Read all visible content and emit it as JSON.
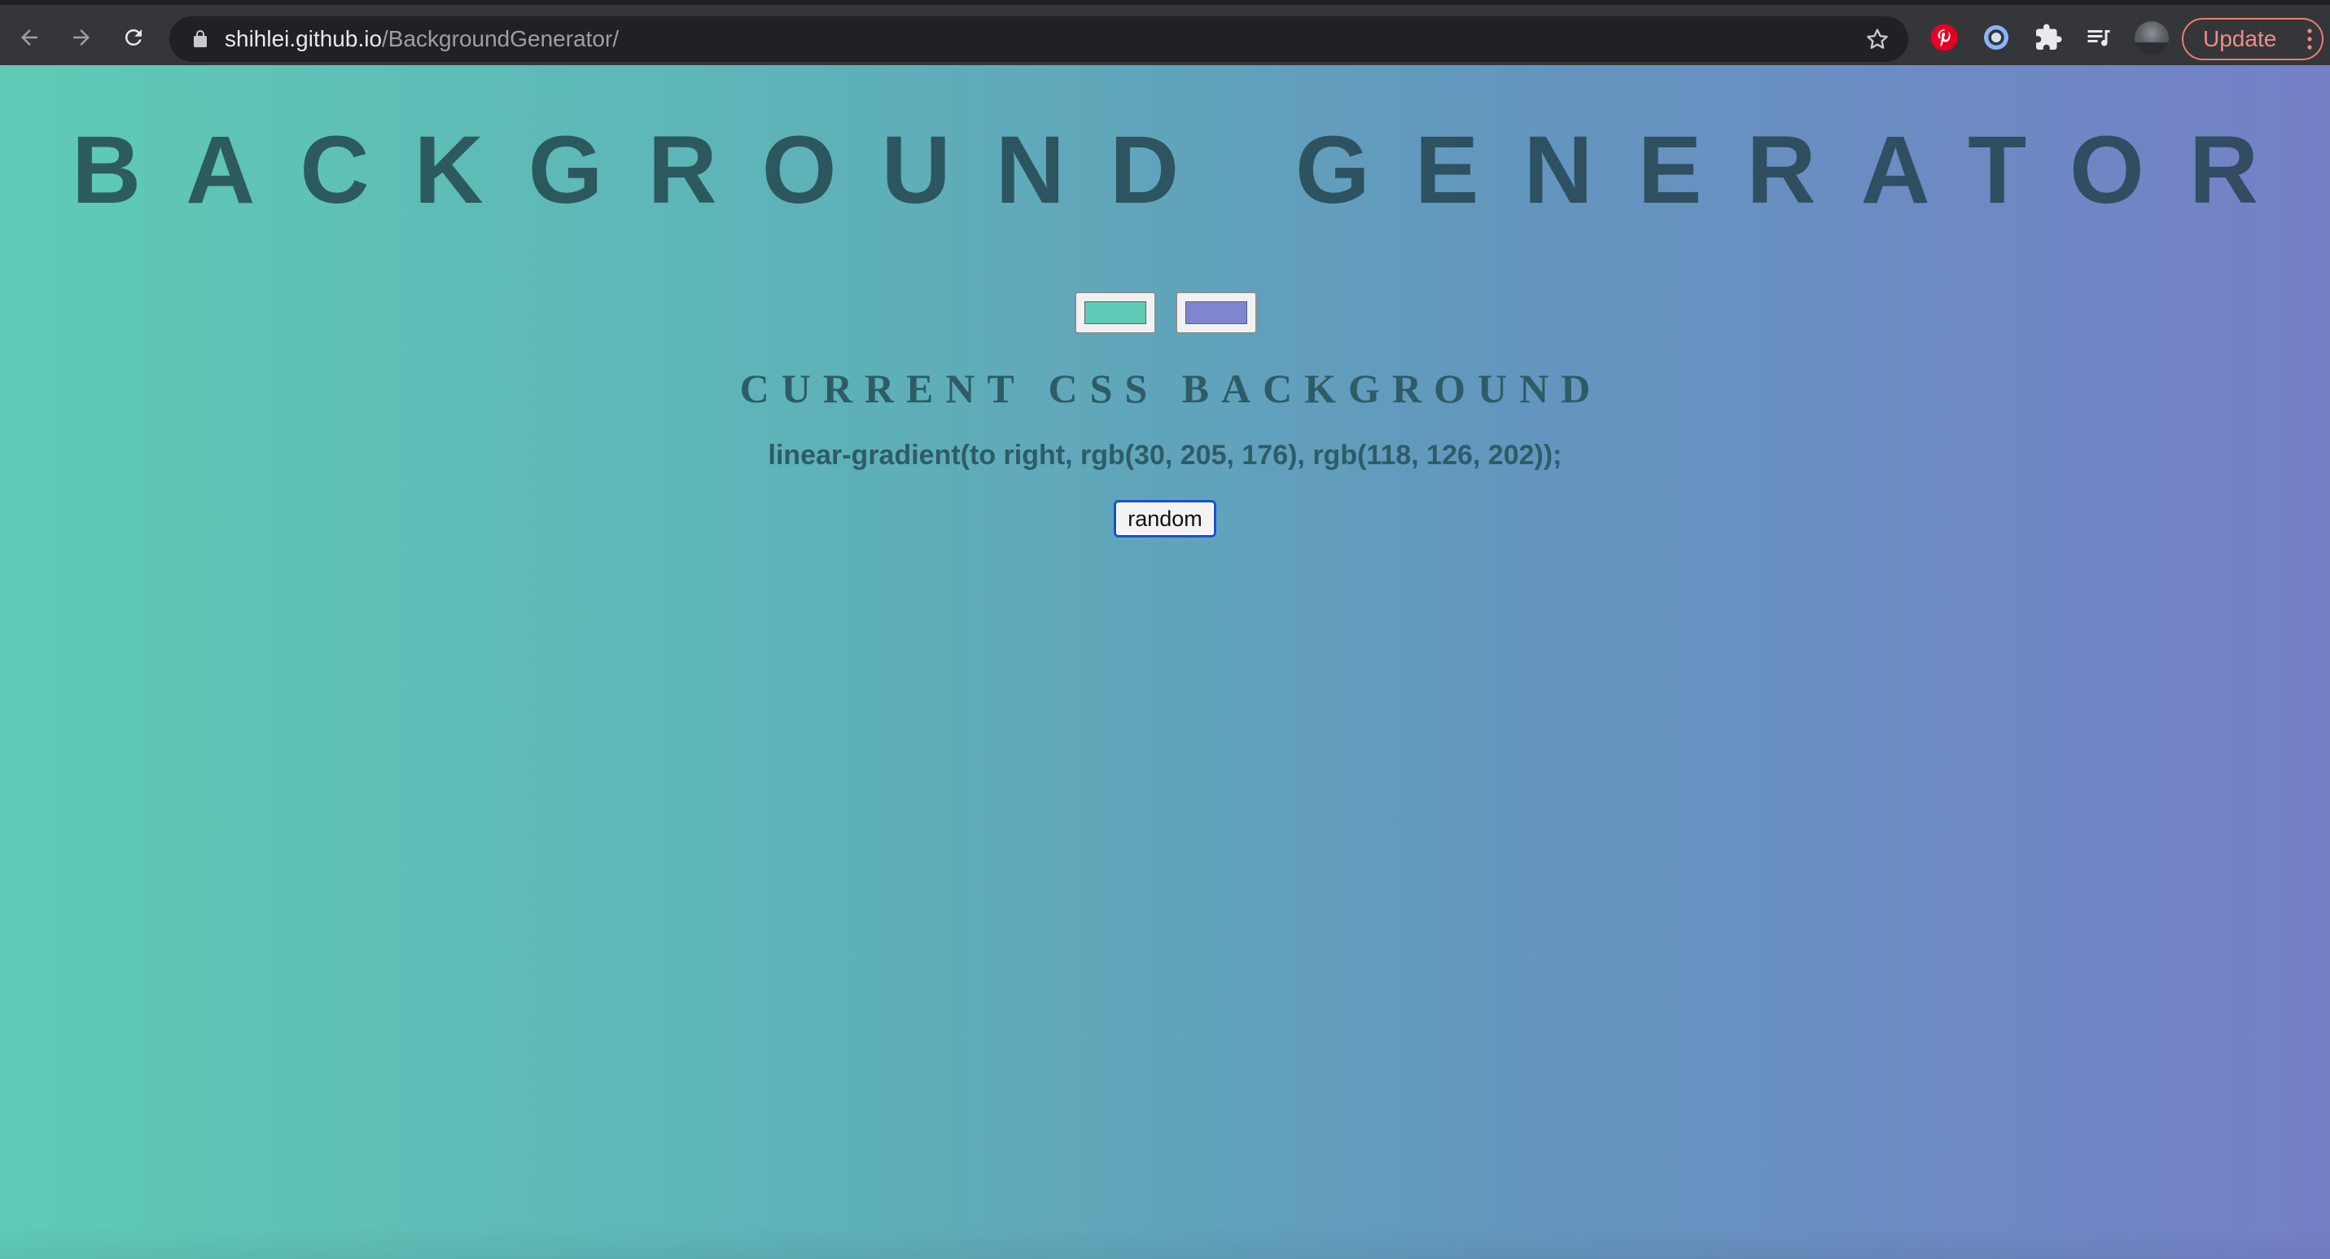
{
  "browser": {
    "url_host": "shihlei.github.io",
    "url_path": "/BackgroundGenerator/",
    "update_label": "Update",
    "colors": {
      "toolbar": "#35363a",
      "omnibox": "#202124",
      "update_accent": "#f28b82"
    },
    "icons": [
      "back-arrow-icon",
      "forward-arrow-icon",
      "reload-icon",
      "lock-icon",
      "star-icon",
      "pinterest-icon",
      "extension-circle-icon",
      "puzzle-icon",
      "media-queue-icon",
      "profile-avatar",
      "more-vertical-icon"
    ]
  },
  "page": {
    "title": "BACKGROUND GENERATOR",
    "subtitle": "CURRENT CSS BACKGROUND",
    "css_value": "linear-gradient(to right, rgb(30, 205, 176), rgb(118, 126, 202));",
    "random_label": "random",
    "color1": "#5fcbb6",
    "color2": "#7f85ce",
    "text_color": "#2e5c66"
  }
}
